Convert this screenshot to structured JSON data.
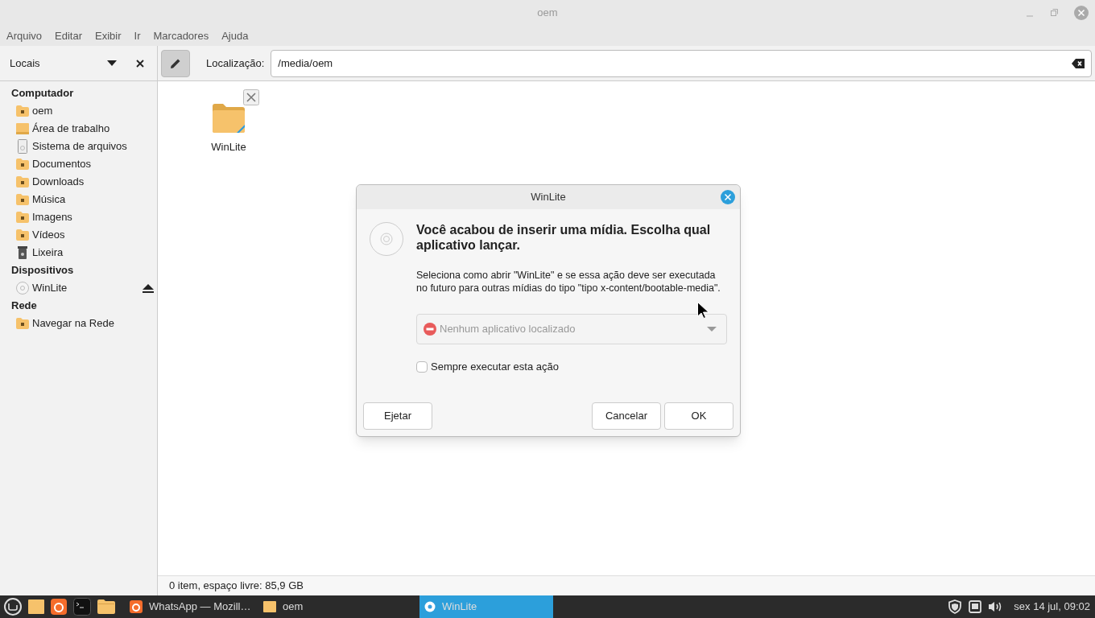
{
  "window": {
    "title": "oem"
  },
  "menu": [
    "Arquivo",
    "Editar",
    "Exibir",
    "Ir",
    "Marcadores",
    "Ajuda"
  ],
  "sidebar": {
    "title": "Locais",
    "sections": [
      {
        "title": "Computador",
        "items": [
          {
            "label": "oem",
            "kind": "home",
            "selected": false
          },
          {
            "label": "Área de trabalho",
            "kind": "desktop",
            "selected": false
          },
          {
            "label": "Sistema de arquivos",
            "kind": "drive",
            "selected": false
          },
          {
            "label": "Documentos",
            "kind": "documents",
            "selected": false
          },
          {
            "label": "Downloads",
            "kind": "downloads",
            "selected": false
          },
          {
            "label": "Música",
            "kind": "music",
            "selected": false
          },
          {
            "label": "Imagens",
            "kind": "pictures",
            "selected": false
          },
          {
            "label": "Vídeos",
            "kind": "videos",
            "selected": false
          },
          {
            "label": "Lixeira",
            "kind": "trash",
            "selected": false
          }
        ]
      },
      {
        "title": "Dispositivos",
        "items": [
          {
            "label": "WinLite",
            "kind": "disc",
            "selected": false,
            "ejectable": true
          }
        ]
      },
      {
        "title": "Rede",
        "items": [
          {
            "label": "Navegar na Rede",
            "kind": "network",
            "selected": false
          }
        ]
      }
    ]
  },
  "location": {
    "label": "Localização:",
    "value": "/media/oem"
  },
  "files": [
    {
      "name": "WinLite",
      "kind": "folder"
    }
  ],
  "status_bar": "0 item, espaço livre: 85,9 GB",
  "dialog": {
    "title": "WinLite",
    "heading": "Você acabou de inserir uma mídia. Escolha qual aplicativo lançar.",
    "message": "Seleciona como abrir \"WinLite\" e se essa ação deve ser executada no futuro para outras mídias do tipo \"tipo x-content/bootable-media\".",
    "dropdown": {
      "value": "Nenhum aplicativo localizado",
      "disabled": true
    },
    "checkbox": {
      "label": "Sempre executar esta ação",
      "checked": false
    },
    "buttons": {
      "left": "Ejetar",
      "right": [
        "Cancelar",
        "OK"
      ]
    }
  },
  "taskbar": {
    "launchers": [
      {
        "kind": "menu"
      },
      {
        "kind": "folder"
      },
      {
        "kind": "firefox"
      },
      {
        "kind": "terminal"
      },
      {
        "kind": "files"
      }
    ],
    "windows": [
      {
        "label": "WhatsApp — Mozill…",
        "kind": "firefox",
        "selected": false
      },
      {
        "label": "oem",
        "kind": "folder",
        "selected": false
      },
      {
        "label": "WinLite",
        "kind": "disc",
        "selected": true
      }
    ],
    "clock": "sex 14 jul, 09:02"
  }
}
